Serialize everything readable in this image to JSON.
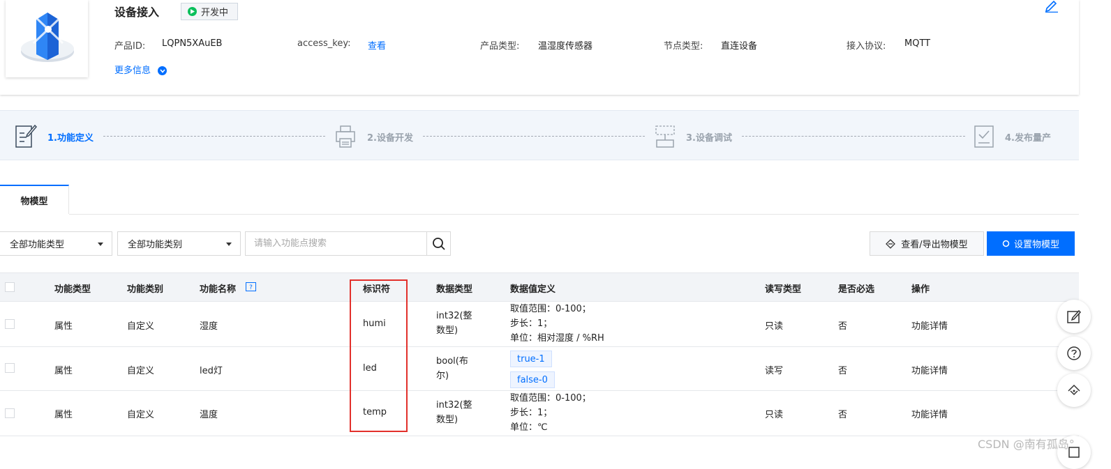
{
  "header": {
    "title": "设备接入",
    "status": "开发中",
    "info": [
      {
        "label": "产品ID:",
        "value": "LQPN5XAuEB"
      },
      {
        "label": "access_key:",
        "value": "查看"
      },
      {
        "label": "产品类型:",
        "value": "温湿度传感器"
      },
      {
        "label": "节点类型:",
        "value": "直连设备"
      },
      {
        "label": "接入协议:",
        "value": "MQTT"
      }
    ],
    "more_info": "更多信息"
  },
  "steps": [
    "1.功能定义",
    "2.设备开发",
    "3.设备调试",
    "4.发布量产"
  ],
  "tabs": [
    "物模型"
  ],
  "toolbar": {
    "type_select": "全部功能类型",
    "category_select": "全部功能类别",
    "search_placeholder": "请输入功能点搜索",
    "export_button": "查看/导出物模型",
    "setup_button": "设置物模型"
  },
  "table": {
    "columns": [
      "功能类型",
      "功能类别",
      "功能名称",
      "标识符",
      "数据类型",
      "数据值定义",
      "读写类型",
      "是否必选",
      "操作"
    ],
    "rows": [
      {
        "type": "属性",
        "category": "自定义",
        "name": "湿度",
        "identifier": "humi",
        "data_type": [
          "int32(整",
          "数型)"
        ],
        "definition": [
          "取值范围：0-100；",
          "步长：1；",
          "单位：相对湿度 / %RH"
        ],
        "rw": "只读",
        "required": "否",
        "action": "功能详情"
      },
      {
        "type": "属性",
        "category": "自定义",
        "name": "led灯",
        "identifier": "led",
        "data_type": [
          "bool(布",
          "尔)"
        ],
        "tags": [
          "true-1",
          "false-0"
        ],
        "rw": "读写",
        "required": "否",
        "action": "功能详情"
      },
      {
        "type": "属性",
        "category": "自定义",
        "name": "温度",
        "identifier": "temp",
        "data_type": [
          "int32(整",
          "数型)"
        ],
        "definition": [
          "取值范围：0-100；",
          "步长：1；",
          "单位：℃"
        ],
        "rw": "只读",
        "required": "否",
        "action": "功能详情"
      }
    ]
  },
  "watermark": "CSDN @南有孤岛°",
  "colors": {
    "accent": "#006eff",
    "status_green": "#0abf5b",
    "highlight": "#e2302b"
  }
}
